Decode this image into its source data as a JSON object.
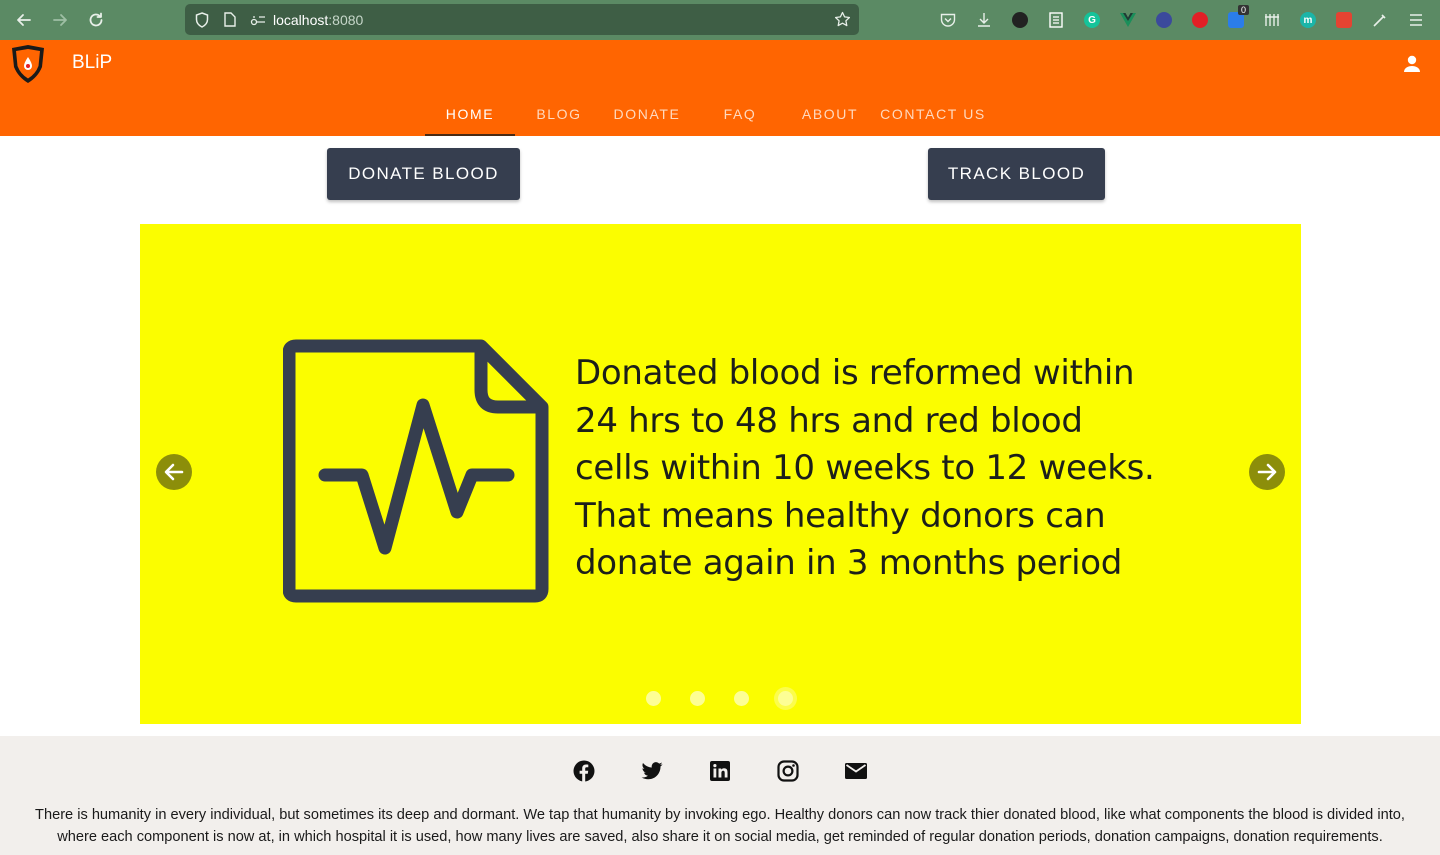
{
  "browser": {
    "url_host": "localhost",
    "url_port": ":8080",
    "extension_badge": "0"
  },
  "header": {
    "brand": "BLiP",
    "menu": [
      {
        "label": "HOME",
        "active": true
      },
      {
        "label": "BLOG",
        "active": false
      },
      {
        "label": "DONATE",
        "active": false
      },
      {
        "label": "FAQ",
        "active": false
      },
      {
        "label": "ABOUT",
        "active": false
      },
      {
        "label": "CONTACT US",
        "active": false
      }
    ]
  },
  "actions": {
    "donate_label": "DONATE BLOOD",
    "track_label": "TRACK BLOOD"
  },
  "carousel": {
    "slide_text_lines": [
      "Donated blood is reformed within",
      "24 hrs to 48 hrs and red blood",
      "cells within 10 weeks to 12 weeks.",
      "That means healthy donors can",
      "donate again in 3 months period"
    ],
    "slide_icon": "medical-report-icon",
    "slide_count": 4,
    "active_index": 3,
    "background": "#fbfd00"
  },
  "footer": {
    "social": [
      "facebook-icon",
      "twitter-icon",
      "linkedin-icon",
      "instagram-icon",
      "email-icon"
    ],
    "text": "There is humanity in every individual, but sometimes its deep and dormant. We tap that humanity by invoking ego. Healthy donors can now track thier donated blood, like what components the blood is divided into, where each component is now at, in which hospital it is used, how many lives are saved, also share it on social media, get reminded of regular donation periods, donation campaigns, donation requirements."
  },
  "colors": {
    "header": "#ff6501",
    "button": "#363e4f",
    "footer": "#f2efec"
  }
}
